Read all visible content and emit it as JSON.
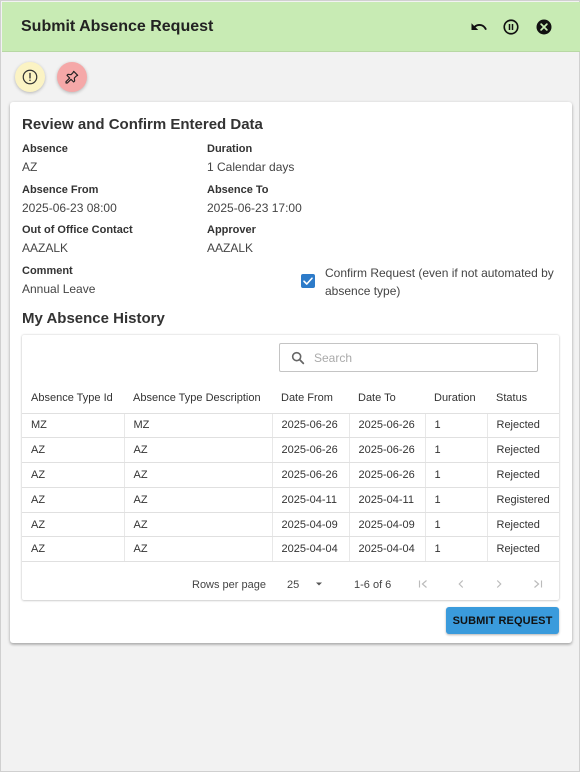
{
  "header": {
    "title": "Submit Absence Request"
  },
  "review": {
    "title": "Review and Confirm Entered Data",
    "fields": {
      "absence_label": "Absence",
      "absence_value": "AZ",
      "duration_label": "Duration",
      "duration_value": "1 Calendar days",
      "from_label": "Absence From",
      "from_value": "2025-06-23 08:00",
      "to_label": "Absence To",
      "to_value": "2025-06-23 17:00",
      "ooo_label": "Out of Office Contact",
      "ooo_value": "AAZALK",
      "approver_label": "Approver",
      "approver_value": "AAZALK",
      "comment_label": "Comment",
      "comment_value": "Annual Leave"
    },
    "confirm_text": "Confirm Request (even if not automated by absence type)"
  },
  "history": {
    "title": "My Absence History",
    "search_placeholder": "Search",
    "columns": [
      "Absence Type Id",
      "Absence Type Description",
      "Date From",
      "Date To",
      "Duration",
      "Status"
    ],
    "rows": [
      [
        "MZ",
        "MZ",
        "2025-06-26",
        "2025-06-26",
        "1",
        "Rejected"
      ],
      [
        "AZ",
        "AZ",
        "2025-06-26",
        "2025-06-26",
        "1",
        "Rejected"
      ],
      [
        "AZ",
        "AZ",
        "2025-06-26",
        "2025-06-26",
        "1",
        "Rejected"
      ],
      [
        "AZ",
        "AZ",
        "2025-04-11",
        "2025-04-11",
        "1",
        "Registered"
      ],
      [
        "AZ",
        "AZ",
        "2025-04-09",
        "2025-04-09",
        "1",
        "Rejected"
      ],
      [
        "AZ",
        "AZ",
        "2025-04-04",
        "2025-04-04",
        "1",
        "Rejected"
      ]
    ],
    "pager": {
      "rows_per_page_label": "Rows per page",
      "rows_per_page_value": "25",
      "range": "1-6 of 6"
    }
  },
  "actions": {
    "submit_label": "SUBMIT REQUEST"
  },
  "colors": {
    "header_bg": "#c8ebb4",
    "info_button": "#fbf3c4",
    "pin_button": "#f5a8a8",
    "accent": "#3a9bdc",
    "checkbox": "#2d7bc9"
  },
  "icons": {
    "undo": "undo-icon",
    "pause": "pause-icon",
    "close": "close-icon",
    "info": "info-icon",
    "pin": "pin-icon",
    "search": "search-icon"
  }
}
